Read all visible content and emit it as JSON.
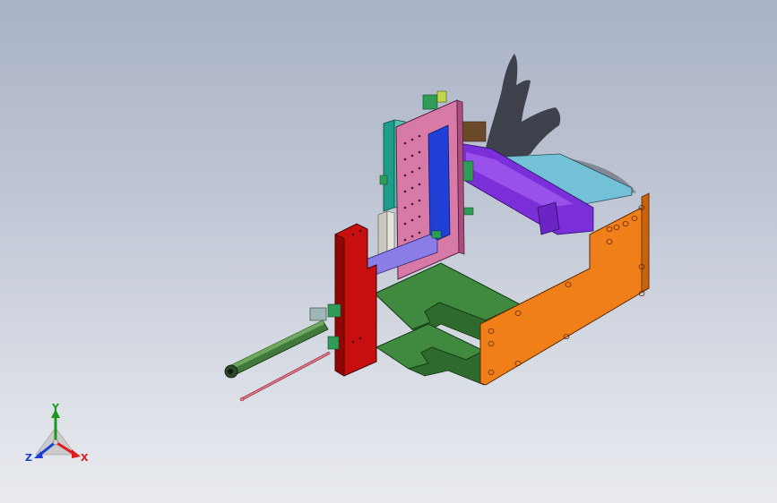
{
  "viewport": {
    "background_top": "#aab3c7",
    "background_bottom": "#e9ebef"
  },
  "model": {
    "parts": [
      {
        "name": "orange-frame-plate",
        "color": "#f07f1a"
      },
      {
        "name": "green-base-plate",
        "color": "#3f8a3f"
      },
      {
        "name": "red-bracket-plate",
        "color": "#c70f0f"
      },
      {
        "name": "pink-vertical-plate",
        "color": "#d77aa8"
      },
      {
        "name": "purple-cylinder",
        "color": "#7a2fd8"
      },
      {
        "name": "cyan-block",
        "color": "#72c1d6"
      },
      {
        "name": "blue-column",
        "color": "#1f3fd6"
      },
      {
        "name": "teal-column",
        "color": "#1e9c8c"
      },
      {
        "name": "olive-rod",
        "color": "#3f7a3a"
      },
      {
        "name": "pink-wire",
        "color": "#e6788c"
      }
    ]
  },
  "triad": {
    "y_label": "Y",
    "z_label": "Z",
    "x_label": "X",
    "y_color": "#1a9a1a",
    "z_color": "#1b3fd6",
    "x_color": "#e01b1b"
  }
}
